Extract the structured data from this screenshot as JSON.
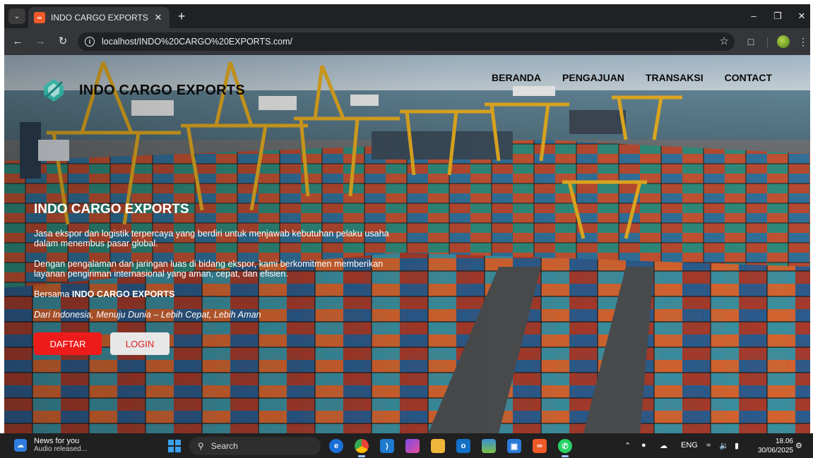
{
  "browser": {
    "tab_title": "INDO CARGO EXPORTS",
    "tab_favicon": "xampp-icon",
    "url": "localhost/INDO%20CARGO%20EXPORTS.com/"
  },
  "site": {
    "brand_name": "INDO CARGO EXPORTS",
    "nav": [
      "BERANDA",
      "PENGAJUAN",
      "TRANSAKSI",
      "CONTACT"
    ],
    "hero": {
      "title": "INDO CARGO EXPORTS",
      "paragraph1": "Jasa ekspor dan logistik terpercaya yang berdiri untuk menjawab kebutuhan pelaku usaha dalam menembus pasar global.",
      "paragraph2": "Dengan pengalaman dan jaringan luas di bidang ekspor, kami berkomitmen memberikan layanan pengiriman internasional yang aman, cepat, dan efisien.",
      "bersama_prefix": "Bersama ",
      "bersama_brand": "INDO CARGO EXPORTS",
      "tagline": "Dari Indonesia, Menuju Dunia – Lebih Cepat, Lebih Aman",
      "btn_daftar": "DAFTAR",
      "btn_login": "LOGIN"
    },
    "colors": {
      "daftar_bg": "#ee1b1b",
      "login_bg": "#e7e7e7",
      "login_text": "#e31b23"
    }
  },
  "taskbar": {
    "news_title": "News for you",
    "news_sub": "Audio released...",
    "search_label": "Search",
    "tray_lang": "ENG",
    "time": "18.06",
    "date": "30/06/2025"
  }
}
